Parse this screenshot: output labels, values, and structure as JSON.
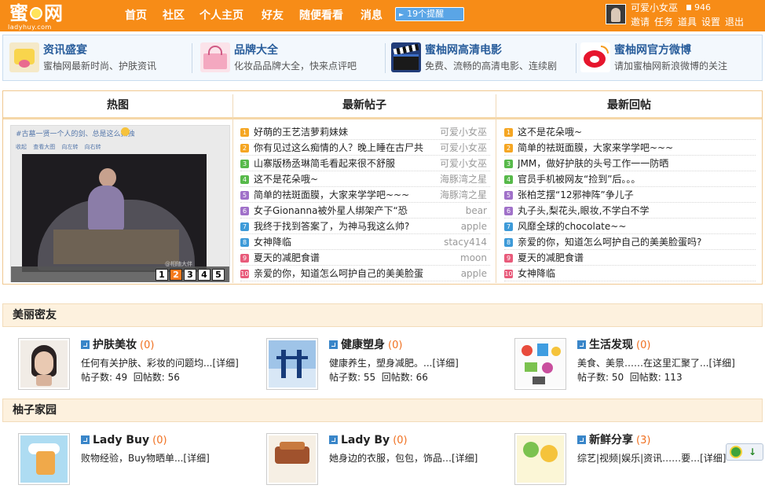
{
  "header": {
    "logo_main": "蜜",
    "logo_tail": "网",
    "logo_domain": "ladyhuy.com",
    "nav": [
      "首页",
      "社区",
      "个人主页",
      "好友",
      "随便看看",
      "消息"
    ],
    "remind": "19个提醒",
    "user_name": "可爱小女巫",
    "coins": "946",
    "user_links": [
      "邀请",
      "任务",
      "道具",
      "设置",
      "退出"
    ]
  },
  "promo": [
    {
      "title": "资讯盛宴",
      "desc": "蜜柚网最新时尚、护肤资讯",
      "icon": "news-icon"
    },
    {
      "title": "品牌大全",
      "desc": "化妆品品牌大全，快来点评吧",
      "icon": "brand-icon"
    },
    {
      "title": "蜜柚网高清电影",
      "desc": "免费、流畅的高清电影、连续剧",
      "icon": "movie-clapper-icon"
    },
    {
      "title": "蜜柚网官方微博",
      "desc": "请加蜜柚网新浪微博的关注",
      "icon": "weibo-icon"
    }
  ],
  "main": {
    "headers": [
      "热图",
      "最新帖子",
      "最新回帖"
    ],
    "hot_caption": "#古墓一贤一个人的剑、总是这么孤独",
    "hot_toolbar": "收起 查看大图 向左转 向右转",
    "hot_watermark": "@相随大伴",
    "pages": [
      "1",
      "2",
      "3",
      "4",
      "5"
    ],
    "active_page": 2,
    "latest_posts": [
      {
        "title": "好萌的王艺洁萝莉妹妹",
        "author": "可爱小女巫"
      },
      {
        "title": "你有见过这么痴情的人？晚上睡在古尸共",
        "author": "可爱小女巫"
      },
      {
        "title": "山寨版杨丞琳简毛看起来很不舒服",
        "author": "可爱小女巫"
      },
      {
        "title": "这不是花朵哦~",
        "author": "海豚湾之星"
      },
      {
        "title": "简单的祛斑面膜，大家来学学吧~~~",
        "author": "海豚湾之星"
      },
      {
        "title": "女子Gionanna被外星人绑架产下“恐",
        "author": "bear"
      },
      {
        "title": "我终于找到答案了，为神马我这么帅?",
        "author": "apple"
      },
      {
        "title": "女神降临",
        "author": "stacy414"
      },
      {
        "title": "夏天的减肥食谱",
        "author": "moon"
      },
      {
        "title": "亲爱的你，知道怎么呵护自己的美美脸蛋",
        "author": "apple"
      }
    ],
    "latest_replies": [
      "这不是花朵哦~",
      "简单的祛斑面膜，大家来学学吧~~~",
      "JMM，做好护肤的头号工作一一防晒",
      "官员手机被网友“捡到”后。。。",
      "张柏芝摆“12邪神阵”争儿子",
      "丸子头,梨花头,眼妆,不学白不学",
      "风靡全球的chocolate~~",
      "亲爱的你，知道怎么呵护自己的美美脸蛋吗?",
      "夏天的减肥食谱",
      "女神降临"
    ],
    "num_colors": [
      "#f5a623",
      "#f5a623",
      "#57b94a",
      "#57b94a",
      "#a071c9",
      "#a071c9",
      "#3d9ad8",
      "#3d9ad8",
      "#e85a7a",
      "#e85a7a"
    ]
  },
  "section1": {
    "title": "美丽密友",
    "cards": [
      {
        "title": "护肤美妆",
        "count": "(0)",
        "desc": "任何有关护肤、彩妆的问题均...[详细]",
        "posts_label": "帖子数:",
        "posts": "49",
        "replies_label": "回帖数:",
        "replies": "56"
      },
      {
        "title": "健康塑身",
        "count": "(0)",
        "desc": "健康养生，塑身减肥。...[详细]",
        "posts_label": "帖子数:",
        "posts": "55",
        "replies_label": "回帖数:",
        "replies": "66"
      },
      {
        "title": "生活发现",
        "count": "(0)",
        "desc": "美食、美景……在这里汇聚了...[详细]",
        "posts_label": "帖子数:",
        "posts": "50",
        "replies_label": "回帖数:",
        "replies": "113"
      }
    ]
  },
  "section2": {
    "title": "柚子家园",
    "cards": [
      {
        "title": "Lady Buy",
        "count": "(0)",
        "desc": "败物经验，Buy物晒单...[详细]"
      },
      {
        "title": "Lady By",
        "count": "(0)",
        "desc": "她身边的衣服，包包，饰品…[详细]"
      },
      {
        "title": "新鲜分享",
        "count": "(3)",
        "desc": "综艺|视频|娱乐|资讯……要…[详细]"
      }
    ]
  },
  "colors": {
    "accent": "#f78c17",
    "link_blue": "#2a5e9c",
    "count_orange": "#f07020"
  }
}
